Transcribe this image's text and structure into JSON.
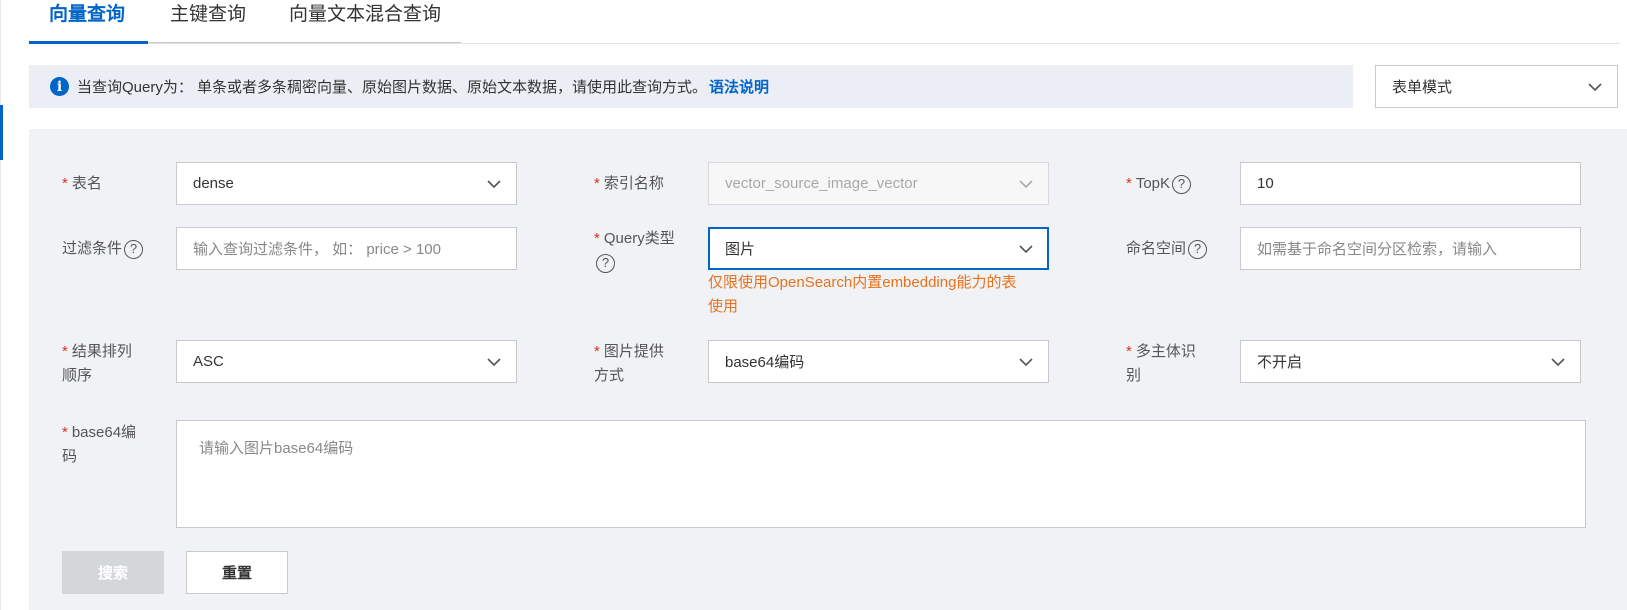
{
  "tabs": [
    {
      "label": "向量查询",
      "active": true
    },
    {
      "label": "主键查询",
      "active": false
    },
    {
      "label": "向量文本混合查询",
      "active": false
    }
  ],
  "info": {
    "text": "当查询Query为： 单条或者多条稠密向量、原始图片数据、原始文本数据，请使用此查询方式。",
    "link": "语法说明"
  },
  "mode_select": {
    "value": "表单模式"
  },
  "form": {
    "table_name": {
      "label": "表名",
      "value": "dense"
    },
    "index_name": {
      "label": "索引名称",
      "value": "vector_source_image_vector"
    },
    "topk": {
      "label": "TopK",
      "value": "10"
    },
    "filter": {
      "label": "过滤条件",
      "placeholder": "输入查询过滤条件， 如： price > 100"
    },
    "query_type": {
      "label": "Query类型",
      "value": "图片",
      "hint": "仅限使用OpenSearch内置embedding能力的表使用",
      "hint_line1": "仅限使用OpenSearch内置embedding能力的表",
      "hint_line2": "使用"
    },
    "namespace": {
      "label": "命名空间",
      "placeholder": "如需基于命名空间分区检索，请输入"
    },
    "sort_order": {
      "label_line1": "结果排列",
      "label_line2": "顺序",
      "value": "ASC"
    },
    "image_source": {
      "label_line1": "图片提供",
      "label_line2": "方式",
      "value": "base64编码"
    },
    "multi_subject": {
      "label_line1": "多主体识",
      "label_line2": "别",
      "value": "不开启"
    },
    "base64": {
      "label_line1": "base64编",
      "label_line2": "码",
      "placeholder": "请输入图片base64编码"
    }
  },
  "buttons": {
    "search": "搜索",
    "reset": "重置"
  },
  "colors": {
    "accent": "#0064c8",
    "required": "#d93026",
    "hint": "#e8711c",
    "panel": "#f0f2f6"
  }
}
